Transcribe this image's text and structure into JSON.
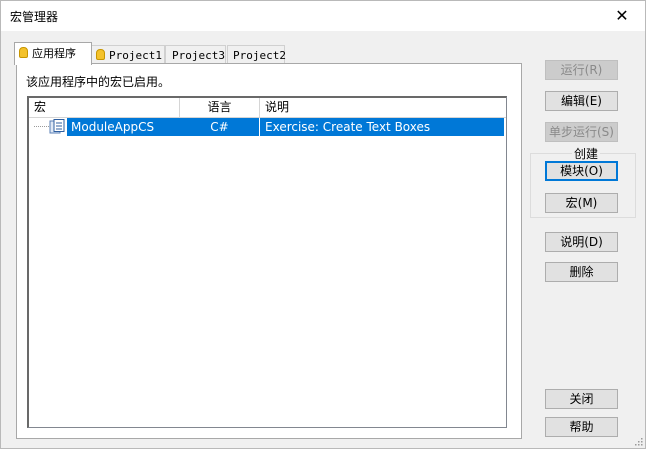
{
  "window": {
    "title": "宏管理器"
  },
  "tabs": [
    {
      "label": "应用程序",
      "active": true,
      "icon": "lightbulb-icon"
    },
    {
      "label": "Project1",
      "active": false,
      "icon": "lightbulb-icon"
    },
    {
      "label": "Project3",
      "active": false
    },
    {
      "label": "Project2",
      "active": false
    }
  ],
  "panel": {
    "enabled_text": "该应用程序中的宏已启用。"
  },
  "table": {
    "columns": [
      "宏",
      "语言",
      "说明"
    ],
    "rows": [
      {
        "macro": "ModuleAppCS",
        "language": "C#",
        "description": "Exercise: Create Text Boxes",
        "selected": true,
        "icon": "module-icon"
      }
    ]
  },
  "buttons": {
    "run": "运行(R)",
    "edit": "编辑(E)",
    "step": "单步运行(S)",
    "create_group": "创建",
    "module": "模块(O)",
    "macro": "宏(M)",
    "description": "说明(D)",
    "delete": "删除",
    "close": "关闭",
    "help": "帮助"
  },
  "colors": {
    "selection": "#0078d7",
    "focus": "#0078d7"
  }
}
